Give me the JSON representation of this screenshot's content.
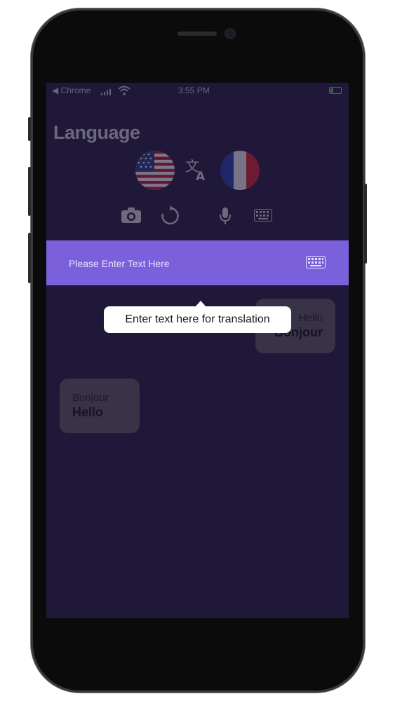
{
  "status_bar": {
    "carrier": "◀ Chrome",
    "time": "3:55 PM"
  },
  "app": {
    "title": "Language"
  },
  "languages": {
    "source_icon": "us-flag-icon",
    "target_icon": "france-flag-icon",
    "swap_icon": "translate-icon"
  },
  "toolbar": {
    "icons": [
      "camera-icon",
      "refresh-icon",
      "microphone-icon",
      "keyboard-icon"
    ]
  },
  "input": {
    "placeholder": "Please Enter Text Here",
    "value": ""
  },
  "conversation": [
    {
      "source": "Hello",
      "translation": "Bonjour"
    },
    {
      "source": "Bonjour",
      "translation": "Hello"
    }
  ],
  "tooltip": {
    "text": "Enter text here for translation"
  },
  "colors": {
    "background": "#1f1838",
    "accent": "#7b60dc",
    "bubble": "#5c5c5c",
    "tooltip": "#ffffff"
  }
}
